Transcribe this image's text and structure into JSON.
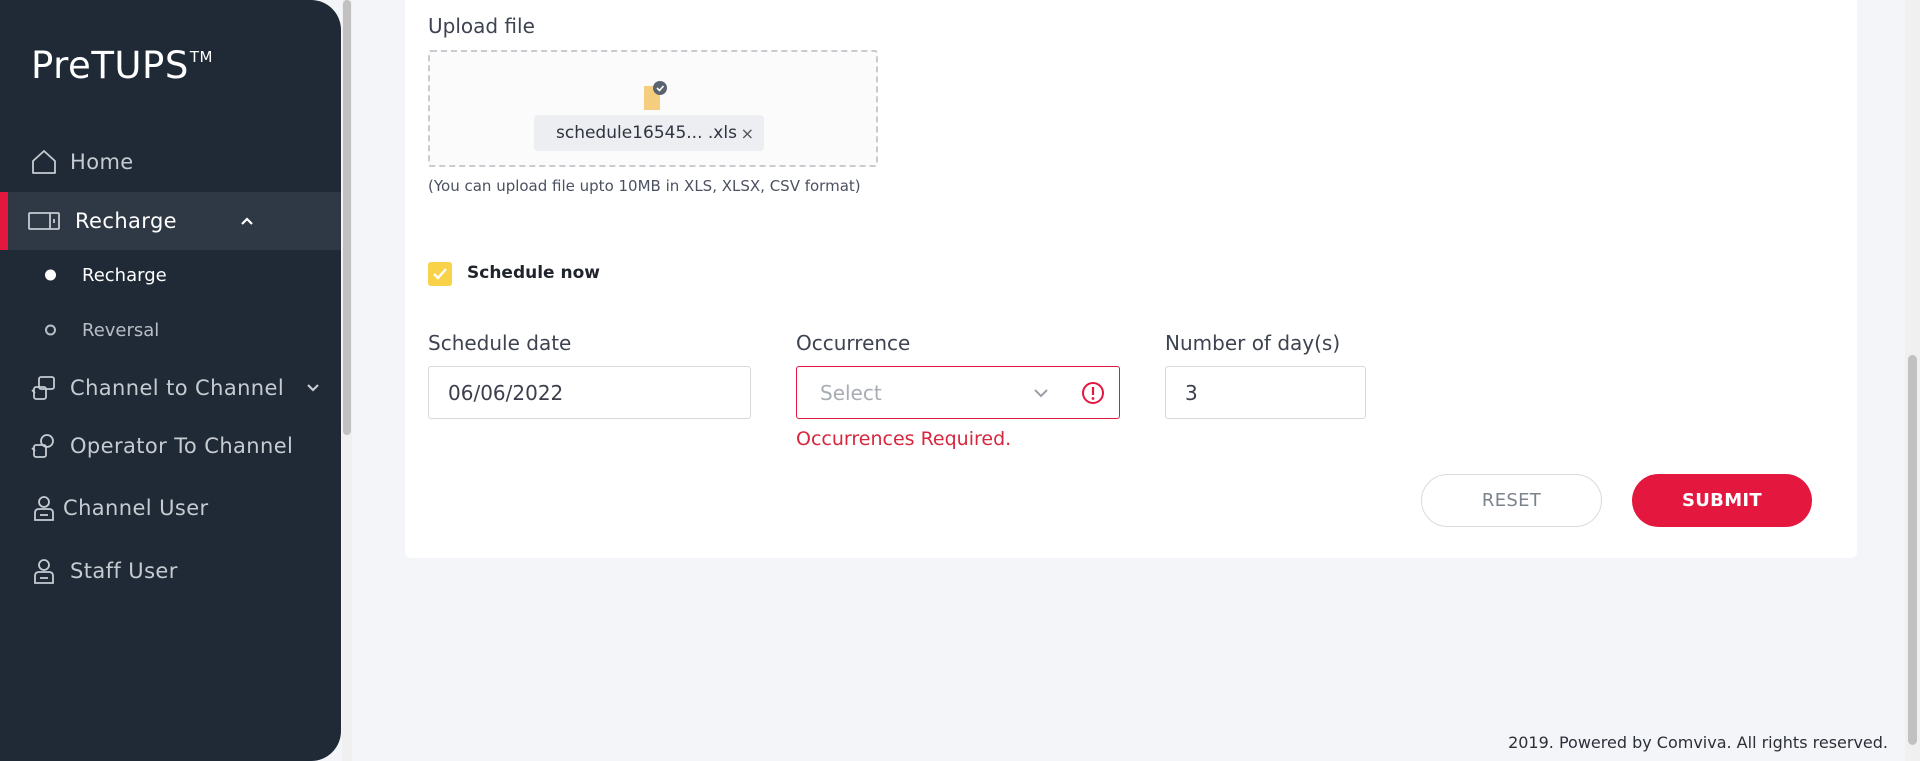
{
  "brand": {
    "name": "PreTUPS",
    "mark": "TM"
  },
  "sidebar": {
    "items": [
      {
        "label": "Home",
        "icon": "home-icon"
      },
      {
        "label": "Recharge",
        "icon": "recharge-card-icon",
        "expanded": true,
        "active": true
      },
      {
        "label": "Channel to Channel",
        "icon": "channel-transfer-icon"
      },
      {
        "label": "Operator To Channel",
        "icon": "operator-transfer-icon"
      },
      {
        "label": "Channel User",
        "icon": "user-icon"
      },
      {
        "label": "Staff User",
        "icon": "user-icon"
      }
    ],
    "sub_items": [
      {
        "label": "Recharge",
        "active": true
      },
      {
        "label": "Reversal",
        "active": false
      }
    ]
  },
  "form": {
    "upload_label": "Upload file",
    "file_name": "schedule16545... .xls",
    "file_remove": "×",
    "upload_hint": "(You can upload file upto 10MB in XLS, XLSX, CSV format)",
    "schedule_now_label": "Schedule now",
    "schedule_now_checked": true,
    "schedule_date_label": "Schedule date",
    "schedule_date_value": "06/06/2022",
    "occurrence_label": "Occurrence",
    "occurrence_placeholder": "Select",
    "occurrence_error": "Occurrences Required.",
    "days_label": "Number of day(s)",
    "days_value": "3",
    "reset_label": "RESET",
    "submit_label": "SUBMIT"
  },
  "colors": {
    "accent": "#e4173f",
    "sidebar_bg": "#1f2a36",
    "checkbox": "#f8d34a",
    "error": "#d7263d"
  },
  "footer": {
    "text": "2019. Powered by Comviva. All rights reserved."
  }
}
